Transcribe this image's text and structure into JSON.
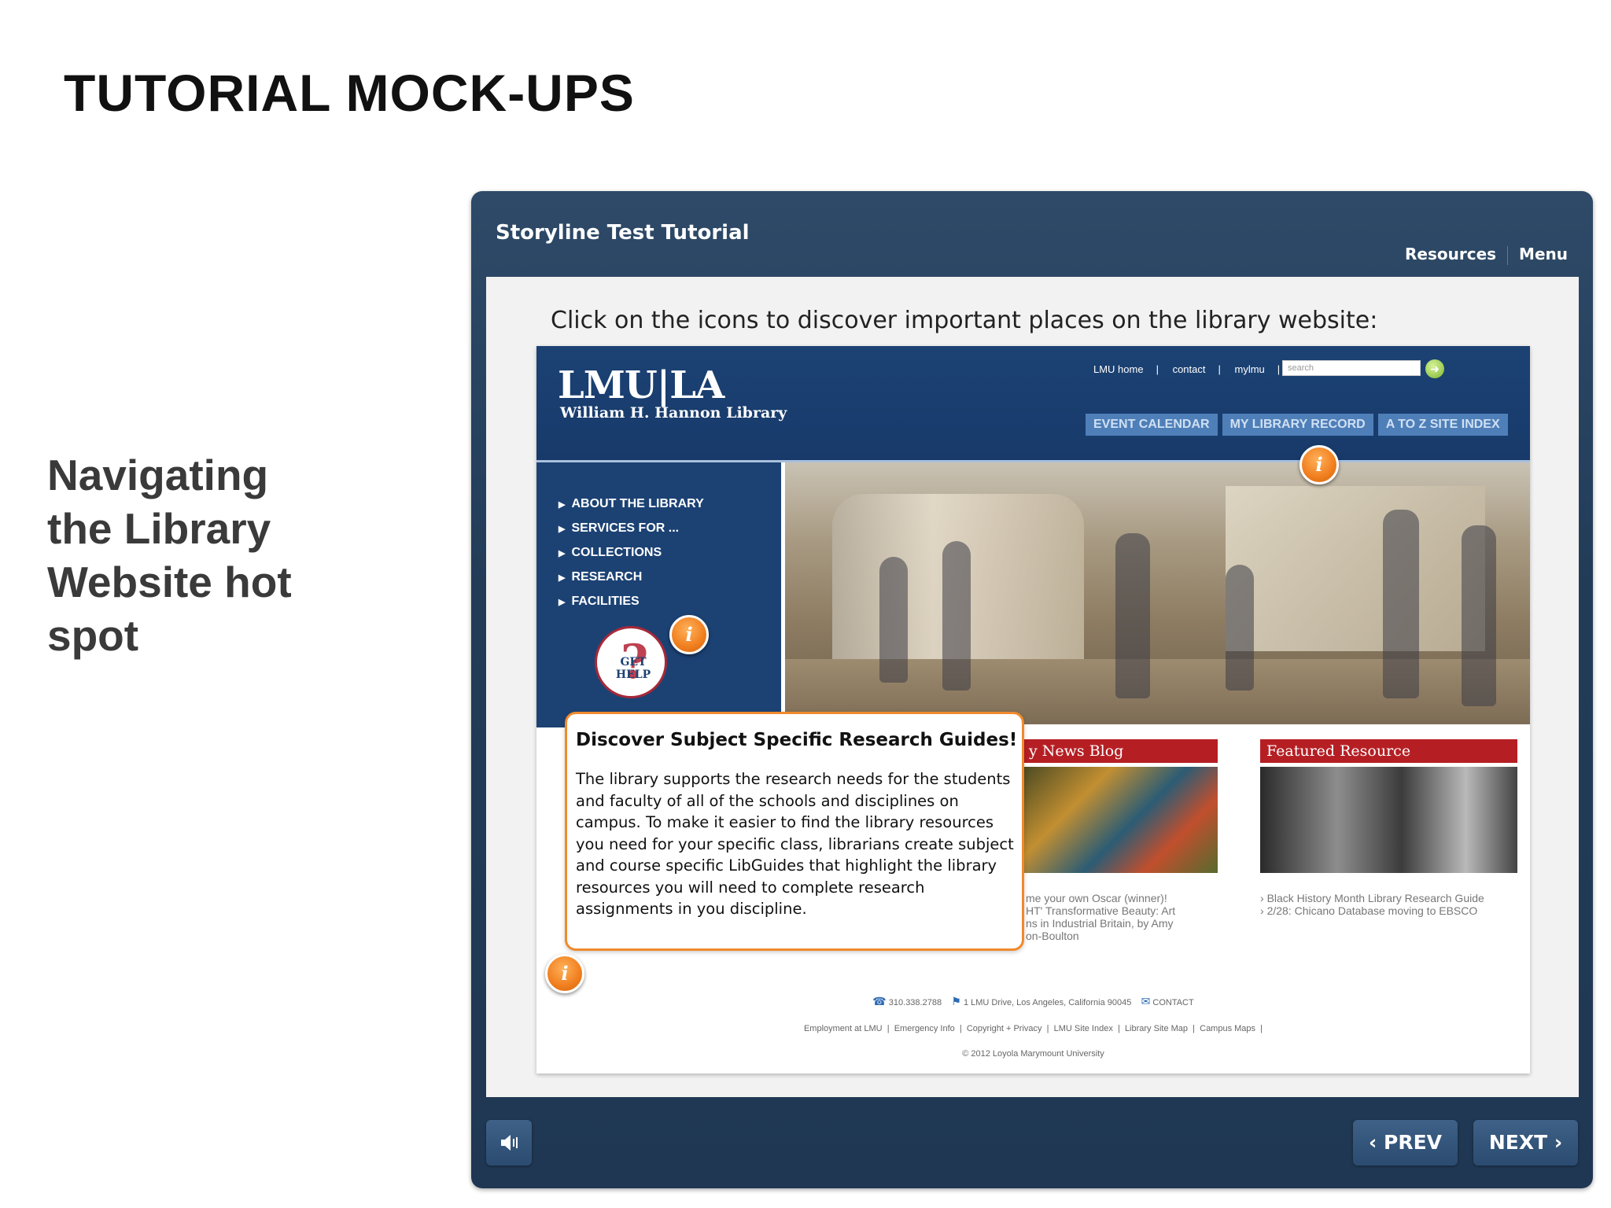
{
  "slide": {
    "title": "TUTORIAL MOCK-UPS",
    "caption": "Navigating the Library Website hot spot"
  },
  "player": {
    "title": "Storyline Test Tutorial",
    "resources_label": "Resources",
    "menu_label": "Menu",
    "instruction": "Click on the icons to discover important places on the library website:",
    "prev_label": "PREV",
    "next_label": "NEXT",
    "volume_icon": "speaker-icon"
  },
  "site": {
    "logo": "LMU|LA",
    "library_name": "William H. Hannon Library",
    "util_links": [
      "LMU home",
      "contact",
      "mylmu"
    ],
    "search_placeholder": "search",
    "tabs": [
      "EVENT CALENDAR",
      "MY LIBRARY RECORD",
      "A TO Z SITE INDEX"
    ],
    "nav": [
      "ABOUT THE LIBRARY",
      "SERVICES FOR ...",
      "COLLECTIONS",
      "RESEARCH",
      "FACILITIES"
    ],
    "get_help": "GET HELP",
    "news_blog_heading": "y News Blog",
    "news_blog_lines": [
      "me your own Oscar (winner)!",
      "HT' Transformative Beauty: Art",
      "ns in Industrial Britain, by Amy",
      "on-Boulton"
    ],
    "featured_heading": "Featured Resource",
    "featured_items": [
      "Black History Month Library Research Guide",
      "2/28: Chicano Database moving to EBSCO"
    ],
    "footer": {
      "phone": "310.338.2788",
      "address": "1 LMU Drive, Los Angeles, California 90045",
      "contact": "CONTACT",
      "links": [
        "Employment at LMU",
        "Emergency Info",
        "Copyright + Privacy",
        "LMU Site Index",
        "Library Site Map",
        "Campus Maps"
      ],
      "copyright": "© 2012 Loyola Marymount University"
    }
  },
  "callout": {
    "title": "Discover Subject Specific Research Guides!",
    "body": "The library supports the research needs for the students and faculty of all of the schools and disciplines on campus. To make it easier to find the library resources you need for your specific class, librarians create subject and course specific LibGuides that highlight the library resources you will need to complete research assignments in you discipline."
  },
  "hotspot_label": "i",
  "colors": {
    "player_bg": "#223c58",
    "site_blue": "#1c4274",
    "accent_orange": "#f07e1e",
    "red_heading": "#b51f24"
  }
}
